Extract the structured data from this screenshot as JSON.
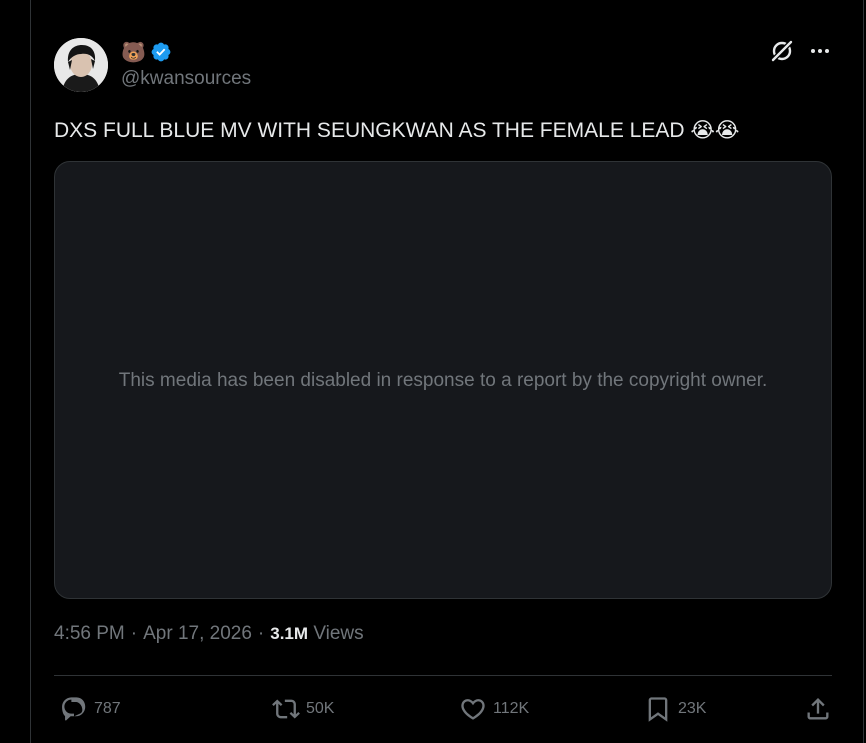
{
  "author": {
    "name_emoji": "🐻",
    "handle": "@kwansources",
    "verified_color": "#1d9bf0"
  },
  "tweet": {
    "text": "DXS FULL BLUE MV WITH SEUNGKWAN AS THE FEMALE LEAD ",
    "emojis": "😭😭"
  },
  "media": {
    "message": "This media has been disabled in response to a report by the copyright owner."
  },
  "meta": {
    "time": "4:56 PM",
    "separator1": "·",
    "date": "Apr 17, 2026",
    "separator2": "·",
    "views_count": "3.1M",
    "views_label": "Views"
  },
  "actions": {
    "reply": {
      "icon": "reply-icon",
      "count": "787"
    },
    "repost": {
      "icon": "repost-icon",
      "count": "50K"
    },
    "like": {
      "icon": "heart-icon",
      "count": "112K"
    },
    "bookmark": {
      "icon": "bookmark-icon",
      "count": "23K"
    },
    "share": {
      "icon": "share-icon"
    }
  },
  "colors": {
    "background": "#000000",
    "text_primary": "#e7e9ea",
    "text_secondary": "#71767b",
    "border": "#2f3336",
    "media_bg": "#16181c"
  }
}
